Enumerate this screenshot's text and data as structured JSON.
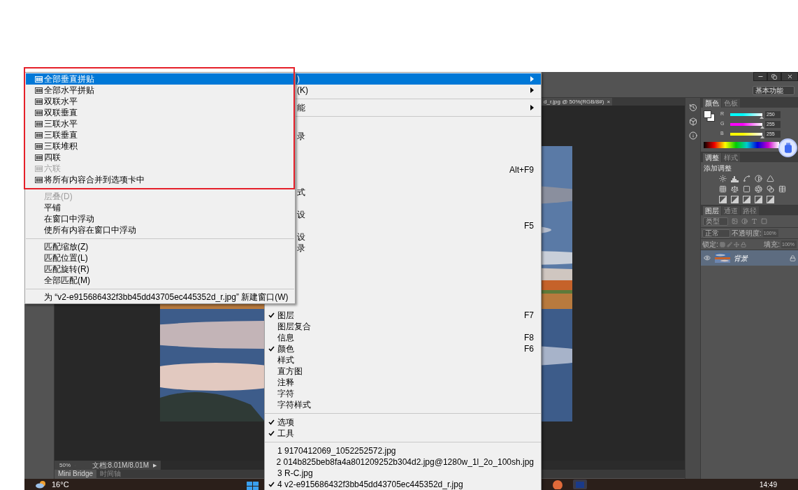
{
  "window_menu": {
    "covered_items": [
      {
        "kind": "item",
        "text": ")",
        "submenu": true,
        "selected": true
      },
      {
        "kind": "item",
        "text": "(K)",
        "submenu": true,
        "selected": false
      },
      {
        "kind": "separator"
      },
      {
        "kind": "item",
        "text": "能",
        "submenu": true,
        "selected": false
      },
      {
        "kind": "separator"
      },
      {
        "kind": "item",
        "selected": false
      },
      {
        "kind": "item",
        "text": "录",
        "selected": false
      },
      {
        "kind": "item",
        "selected": false
      },
      {
        "kind": "item",
        "selected": false
      },
      {
        "kind": "item",
        "shortcut": "Alt+F9",
        "selected": false
      },
      {
        "kind": "item",
        "selected": false
      },
      {
        "kind": "item",
        "text": "式",
        "selected": false
      },
      {
        "kind": "item",
        "selected": false
      },
      {
        "kind": "item",
        "text": "设",
        "selected": false
      },
      {
        "kind": "item",
        "shortcut": "F5",
        "selected": false
      },
      {
        "kind": "item",
        "text": "设",
        "selected": false
      },
      {
        "kind": "item",
        "text": "录",
        "selected": false
      },
      {
        "kind": "item",
        "selected": false
      },
      {
        "kind": "item",
        "selected": false
      },
      {
        "kind": "item",
        "selected": false
      },
      {
        "kind": "item",
        "selected": false
      }
    ],
    "items": [
      {
        "kind": "item",
        "checked": false,
        "selected": false
      },
      {
        "kind": "item",
        "text": "图层",
        "shortcut": "F7",
        "checked": true,
        "selected": false
      },
      {
        "kind": "item",
        "text": "图层复合",
        "checked": false,
        "selected": false
      },
      {
        "kind": "item",
        "text": "信息",
        "shortcut": "F8",
        "checked": false,
        "selected": false
      },
      {
        "kind": "item",
        "text": "颜色",
        "shortcut": "F6",
        "checked": true,
        "selected": false
      },
      {
        "kind": "item",
        "text": "样式",
        "checked": false,
        "selected": false
      },
      {
        "kind": "item",
        "text": "直方图",
        "checked": false,
        "selected": false
      },
      {
        "kind": "item",
        "text": "注释",
        "checked": false,
        "selected": false
      },
      {
        "kind": "item",
        "text": "字符",
        "checked": false,
        "selected": false
      },
      {
        "kind": "item",
        "text": "字符样式",
        "checked": false,
        "selected": false
      },
      {
        "kind": "separator"
      },
      {
        "kind": "item",
        "text": "选项",
        "checked": true,
        "selected": false
      },
      {
        "kind": "item",
        "text": "工具",
        "checked": true,
        "selected": false
      },
      {
        "kind": "separator"
      },
      {
        "kind": "item",
        "text": "1 9170412069_1052252572.jpg",
        "checked": false,
        "selected": false
      },
      {
        "kind": "item",
        "text": "2 014b825beb8fa4a801209252b304d2.jpg@1280w_1l_2o_100sh.jpg",
        "checked": false,
        "selected": false
      },
      {
        "kind": "item",
        "text": "3 R-C.jpg",
        "checked": false,
        "selected": false
      },
      {
        "kind": "item",
        "text": "4 v2-e915686432f3bb45dd43705ec445352d_r.jpg",
        "checked": true,
        "selected": false
      }
    ]
  },
  "arrange_submenu": {
    "groups": [
      [
        {
          "kind": "layout",
          "label": "全部垂直拼贴",
          "selected": true,
          "disabled": false
        },
        {
          "kind": "layout",
          "label": "全部水平拼贴",
          "selected": false,
          "disabled": false
        },
        {
          "kind": "layout",
          "label": "双联水平",
          "selected": false,
          "disabled": false
        },
        {
          "kind": "layout",
          "label": "双联垂直",
          "selected": false,
          "disabled": false
        },
        {
          "kind": "layout",
          "label": "三联水平",
          "selected": false,
          "disabled": false
        },
        {
          "kind": "layout",
          "label": "三联垂直",
          "selected": false,
          "disabled": false
        },
        {
          "kind": "layout",
          "label": "三联堆积",
          "selected": false,
          "disabled": false
        },
        {
          "kind": "layout",
          "label": "四联",
          "selected": false,
          "disabled": false
        },
        {
          "kind": "layout",
          "label": "六联",
          "selected": false,
          "disabled": true
        },
        {
          "kind": "layout",
          "label": "将所有内容合并到选项卡中",
          "selected": false,
          "disabled": false
        }
      ],
      [
        {
          "kind": "text",
          "label": "层叠(D)",
          "selected": false,
          "disabled": true
        },
        {
          "kind": "text",
          "label": "平铺",
          "selected": false,
          "disabled": false
        },
        {
          "kind": "text",
          "label": "在窗口中浮动",
          "selected": false,
          "disabled": false
        },
        {
          "kind": "text",
          "label": "使所有内容在窗口中浮动",
          "selected": false,
          "disabled": false
        }
      ],
      [
        {
          "kind": "text",
          "label": "匹配缩放(Z)",
          "selected": false,
          "disabled": false
        },
        {
          "kind": "text",
          "label": "匹配位置(L)",
          "selected": false,
          "disabled": false
        },
        {
          "kind": "text",
          "label": "匹配旋转(R)",
          "selected": false,
          "disabled": false
        },
        {
          "kind": "text",
          "label": "全部匹配(M)",
          "selected": false,
          "disabled": false
        }
      ],
      [
        {
          "kind": "text",
          "label": "为 “v2-e915686432f3bb45dd43705ec445352d_r.jpg” 新建窗口(W)",
          "selected": false,
          "disabled": false
        }
      ]
    ]
  },
  "workspace": {
    "label": "基本功能"
  },
  "document_tab": {
    "title": "d_r.jpg @ 50%(RGB/8#)",
    "close": "×"
  },
  "status_bar": {
    "zoom": "50%",
    "doc_info": "文档:8.01M/8.01M",
    "arrow": "▶"
  },
  "bottom_tabs": [
    {
      "label": "Mini Bridge",
      "selected": true
    },
    {
      "label": "时间轴",
      "selected": false
    }
  ],
  "color_panel": {
    "tabs": [
      {
        "label": "颜色",
        "selected": true
      },
      {
        "label": "色板",
        "selected": false
      }
    ],
    "channels": [
      {
        "name": "R",
        "value": "250",
        "level": 0.98,
        "color": "#00ffff"
      },
      {
        "name": "G",
        "value": "255",
        "level": 1,
        "color": "#ff00ff"
      },
      {
        "name": "B",
        "value": "255",
        "level": 1,
        "color": "#ffff00"
      }
    ]
  },
  "adjustments_panel": {
    "tabs": [
      {
        "label": "调整",
        "selected": true
      },
      {
        "label": "样式",
        "selected": false
      }
    ],
    "heading": "添加调整"
  },
  "layers_panel": {
    "tabs": [
      {
        "label": "图层",
        "selected": true
      },
      {
        "label": "通道",
        "selected": false
      },
      {
        "label": "路径",
        "selected": false
      }
    ],
    "filter": "类型",
    "blend_mode": "正常",
    "opacity_label": "不透明度:",
    "opacity": "100%",
    "lock_label": "锁定:",
    "fill_label": "填充:",
    "fill": "100%",
    "layers": [
      {
        "name": "背景",
        "selected": true,
        "visible": true,
        "locked": true
      }
    ]
  },
  "taskbar": {
    "temperature": "16°C",
    "clock": "14:49"
  }
}
